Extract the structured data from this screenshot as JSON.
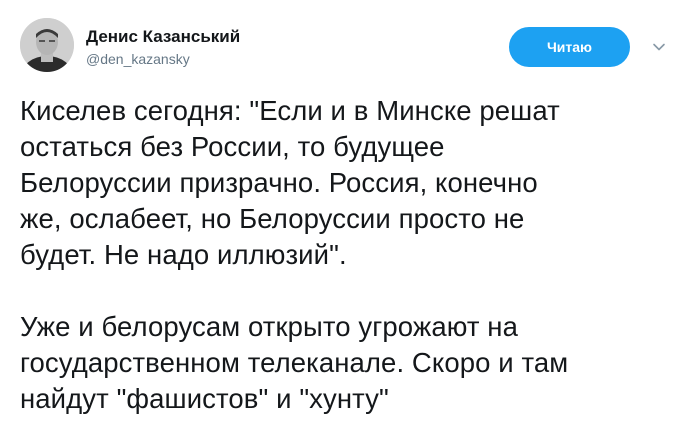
{
  "tweet": {
    "author_name": "Денис Казанський",
    "author_handle": "@den_kazansky",
    "follow_label": "Читаю",
    "menu_icon": "chevron-down-icon",
    "avatar_icon": "avatar",
    "paragraphs": [
      [
        "Киселев сегодня: \"Если и в Минске решат",
        "остаться без России, то будущее",
        "Белоруссии призрачно. Россия, конечно",
        "же, ослабеет, но Белоруссии просто не",
        "будет. Не надо иллюзий\"."
      ],
      [
        "Уже и белорусам открыто угрожают на",
        "государственном телеканале. Скоро и там",
        "найдут \"фашистов\" и \"хунту\""
      ]
    ]
  },
  "colors": {
    "accent": "#1da1f2",
    "text": "#14171a",
    "secondary": "#657786"
  }
}
